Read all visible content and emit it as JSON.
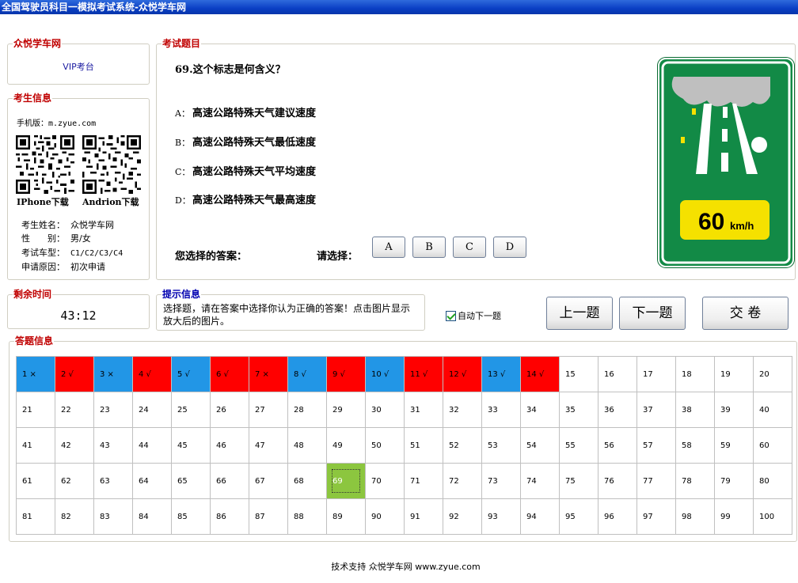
{
  "window": {
    "title": "全国驾驶员科目一模拟考试系统-众悦学车网"
  },
  "brand": {
    "group_title": "众悦学车网",
    "vip_label": "VIP考台"
  },
  "examinee": {
    "group_title": "考生信息",
    "mobile_line": "手机版：m.zyue.com",
    "iphone_label": "IPhone下载",
    "android_label": "Andrion下载",
    "name_label": "考生姓名：",
    "name_value": "众悦学车网",
    "gender_label": "性　　别：",
    "gender_value": "男/女",
    "car_label": "考试车型：",
    "car_value": "C1/C2/C3/C4",
    "reason_label": "申请原因：",
    "reason_value": "初次申请"
  },
  "timer": {
    "group_title": "剩余时间",
    "value": "43:12"
  },
  "question": {
    "group_title": "考试题目",
    "text": "69.这个标志是何含义？",
    "options": [
      {
        "key": "A：",
        "text": "高速公路特殊天气建议速度"
      },
      {
        "key": "B：",
        "text": "高速公路特殊天气最低速度"
      },
      {
        "key": "C：",
        "text": "高速公路特殊天气平均速度"
      },
      {
        "key": "D：",
        "text": "高速公路特殊天气最高速度"
      }
    ],
    "your_answer_label": "您选择的答案：",
    "choose_label": "请选择：",
    "buttons": [
      "A",
      "B",
      "C",
      "D"
    ]
  },
  "sign": {
    "speed": "60",
    "unit": "km/h",
    "colors": {
      "green": "#128a46",
      "yellow": "#f5e100",
      "cloud": "#bfbfbf"
    }
  },
  "hint": {
    "group_title": "提示信息",
    "text": "选择题，请在答案中选择你认为正确的答案！点击图片显示放大后的图片。"
  },
  "auto_next": {
    "label": "自动下一题",
    "checked": true
  },
  "nav": {
    "prev": "上一题",
    "next": "下一题",
    "submit": "交 卷"
  },
  "answer_grid": {
    "group_title": "答题信息",
    "status_colors": {
      "wrong": "#2296e6",
      "right": "#ff0000",
      "current": "#8cc63f"
    },
    "cells": [
      {
        "label": "1 ×",
        "status": "wrong"
      },
      {
        "label": "2 √",
        "status": "right"
      },
      {
        "label": "3 ×",
        "status": "wrong"
      },
      {
        "label": "4 √",
        "status": "right"
      },
      {
        "label": "5 √",
        "status": "wrong"
      },
      {
        "label": "6 √",
        "status": "right"
      },
      {
        "label": "7 ×",
        "status": "right"
      },
      {
        "label": "8 √",
        "status": "wrong"
      },
      {
        "label": "9 √",
        "status": "right"
      },
      {
        "label": "10 √",
        "status": "wrong"
      },
      {
        "label": "11 √",
        "status": "right"
      },
      {
        "label": "12 √",
        "status": "right"
      },
      {
        "label": "13 √",
        "status": "wrong"
      },
      {
        "label": "14 √",
        "status": "right"
      },
      {
        "label": "15"
      },
      {
        "label": "16"
      },
      {
        "label": "17"
      },
      {
        "label": "18"
      },
      {
        "label": "19"
      },
      {
        "label": "20"
      },
      {
        "label": "21"
      },
      {
        "label": "22"
      },
      {
        "label": "23"
      },
      {
        "label": "24"
      },
      {
        "label": "25"
      },
      {
        "label": "26"
      },
      {
        "label": "27"
      },
      {
        "label": "28"
      },
      {
        "label": "29"
      },
      {
        "label": "30"
      },
      {
        "label": "31"
      },
      {
        "label": "32"
      },
      {
        "label": "33"
      },
      {
        "label": "34"
      },
      {
        "label": "35"
      },
      {
        "label": "36"
      },
      {
        "label": "37"
      },
      {
        "label": "38"
      },
      {
        "label": "39"
      },
      {
        "label": "40"
      },
      {
        "label": "41"
      },
      {
        "label": "42"
      },
      {
        "label": "43"
      },
      {
        "label": "44"
      },
      {
        "label": "45"
      },
      {
        "label": "46"
      },
      {
        "label": "47"
      },
      {
        "label": "48"
      },
      {
        "label": "49"
      },
      {
        "label": "50"
      },
      {
        "label": "51"
      },
      {
        "label": "52"
      },
      {
        "label": "53"
      },
      {
        "label": "54"
      },
      {
        "label": "55"
      },
      {
        "label": "56"
      },
      {
        "label": "57"
      },
      {
        "label": "58"
      },
      {
        "label": "59"
      },
      {
        "label": "60"
      },
      {
        "label": "61"
      },
      {
        "label": "62"
      },
      {
        "label": "63"
      },
      {
        "label": "64"
      },
      {
        "label": "65"
      },
      {
        "label": "66"
      },
      {
        "label": "67"
      },
      {
        "label": "68"
      },
      {
        "label": "69",
        "status": "current"
      },
      {
        "label": "70"
      },
      {
        "label": "71"
      },
      {
        "label": "72"
      },
      {
        "label": "73"
      },
      {
        "label": "74"
      },
      {
        "label": "75"
      },
      {
        "label": "76"
      },
      {
        "label": "77"
      },
      {
        "label": "78"
      },
      {
        "label": "79"
      },
      {
        "label": "80"
      },
      {
        "label": "81"
      },
      {
        "label": "82"
      },
      {
        "label": "83"
      },
      {
        "label": "84"
      },
      {
        "label": "85"
      },
      {
        "label": "86"
      },
      {
        "label": "87"
      },
      {
        "label": "88"
      },
      {
        "label": "89"
      },
      {
        "label": "90"
      },
      {
        "label": "91"
      },
      {
        "label": "92"
      },
      {
        "label": "93"
      },
      {
        "label": "94"
      },
      {
        "label": "95"
      },
      {
        "label": "96"
      },
      {
        "label": "97"
      },
      {
        "label": "98"
      },
      {
        "label": "99"
      },
      {
        "label": "100"
      }
    ]
  },
  "footer": {
    "text": "技术支持 众悦学车网 www.zyue.com"
  }
}
